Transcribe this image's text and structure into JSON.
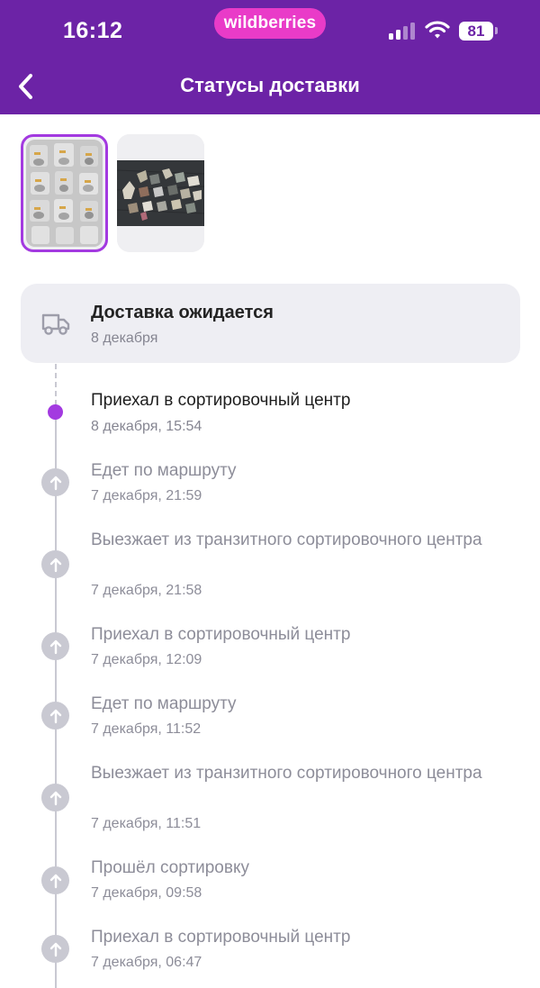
{
  "status_bar": {
    "time": "16:12",
    "brand": "wildberries",
    "battery": "81"
  },
  "header": {
    "title": "Статусы доставки"
  },
  "colors": {
    "header_bg": "#6c23a6",
    "brand_pill": "#e93bc8",
    "accent": "#a33ae0",
    "inactive": "#c9c9d2"
  },
  "icons": {
    "back": "chevron-left-icon",
    "card": "truck-icon",
    "step": "arrow-up-icon"
  },
  "delivery": {
    "title": "Доставка ожидается",
    "date": "8 декабря"
  },
  "events": [
    {
      "title": "Приехал в сортировочный центр",
      "time": "8 декабря, 15:54"
    },
    {
      "title": "Едет по маршруту",
      "time": "7 декабря, 21:59"
    },
    {
      "title": "Выезжает из транзитного сортировочного центра",
      "time": "7 декабря, 21:58"
    },
    {
      "title": "Приехал в сортировочный центр",
      "time": "7 декабря, 12:09"
    },
    {
      "title": "Едет по маршруту",
      "time": "7 декабря, 11:52"
    },
    {
      "title": "Выезжает из транзитного сортировочного центра",
      "time": "7 декабря, 11:51"
    },
    {
      "title": "Прошёл сортировку",
      "time": "7 декабря, 09:58"
    },
    {
      "title": "Приехал в сортировочный центр",
      "time": "7 декабря, 06:47"
    }
  ]
}
